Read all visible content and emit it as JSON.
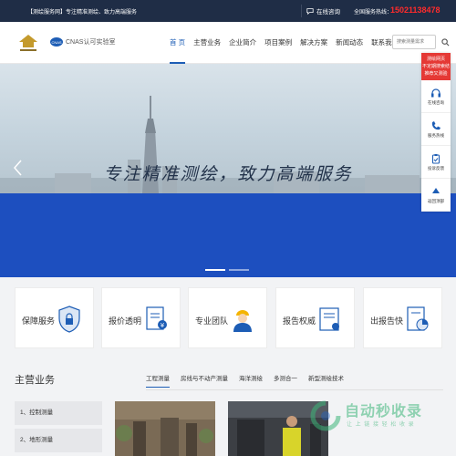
{
  "topbar": {
    "notice": "【测绘服务网】专注精准测绘、致力高端服务",
    "online_chat": "在线咨询",
    "hotline_label": "全国服务热线：",
    "hotline_number": "15021138478"
  },
  "nav": {
    "cnas_badge": "CNAS",
    "cnas_label": "CNAS认可实验室",
    "items": [
      "首 页",
      "主营业务",
      "企业简介",
      "项目案例",
      "解决方案",
      "新闻动态",
      "联系我们"
    ],
    "active_index": 0,
    "search_placeholder": "搜索测量需求"
  },
  "banner": {
    "slogan": "专注精准测绘，致力高端服务",
    "slide_count": 2,
    "active_slide": 0
  },
  "sidebar": {
    "alert": [
      "测绘网页",
      "不定期搜索结",
      "推荐又测验"
    ],
    "buttons": [
      "在线咨询",
      "服务热线",
      "投诉反馈",
      "返回顶部"
    ]
  },
  "features": [
    "保障服务",
    "报价透明",
    "专业团队",
    "报告权威",
    "出报告快"
  ],
  "services": {
    "title": "主营业务",
    "tabs": [
      "工程测量",
      "房线与不动产测量",
      "海洋测绘",
      "多测合一",
      "新型测绘技术"
    ],
    "active_tab": 0,
    "list": [
      "1、控制测量",
      "2、地形测量"
    ]
  },
  "watermark": {
    "title": "自动秒收录",
    "subtitle": "让 上 链 接   轻 松 收 录"
  },
  "colors": {
    "brand": "#1d5db5",
    "topbar": "#1f2d46",
    "hotline": "#ff2b2b",
    "banner_blue": "#1d4fbf",
    "alert_red": "#e53935"
  }
}
